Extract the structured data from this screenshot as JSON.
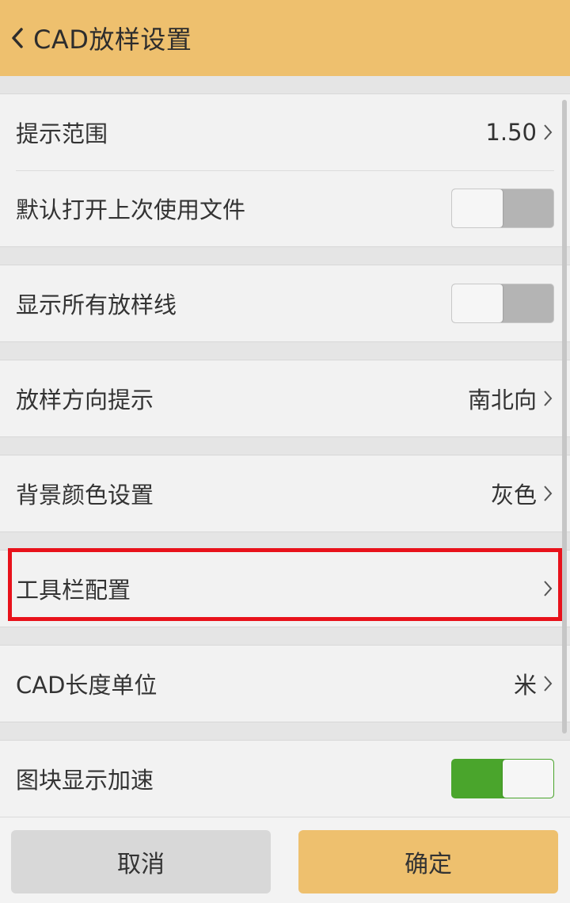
{
  "header": {
    "title": "CAD放样设置",
    "back_icon": "chevron-left-icon"
  },
  "rows": {
    "hint_range": {
      "label": "提示范围",
      "value": "1.50"
    },
    "open_last_file": {
      "label": "默认打开上次使用文件",
      "toggle": "off"
    },
    "show_all_lines": {
      "label": "显示所有放样线",
      "toggle": "off"
    },
    "direction_hint": {
      "label": "放样方向提示",
      "value": "南北向"
    },
    "background_color": {
      "label": "背景颜色设置",
      "value": "灰色"
    },
    "toolbar_config": {
      "label": "工具栏配置",
      "value": ""
    },
    "cad_length_unit": {
      "label": "CAD长度单位",
      "value": "米"
    },
    "block_display_accel": {
      "label": "图块显示加速",
      "toggle": "on"
    }
  },
  "footer": {
    "cancel_label": "取消",
    "confirm_label": "确定"
  },
  "colors": {
    "header_bg": "#eec06e",
    "confirm_bg": "#eec06e",
    "toggle_on": "#4aa52c",
    "highlight": "#e8121b"
  }
}
